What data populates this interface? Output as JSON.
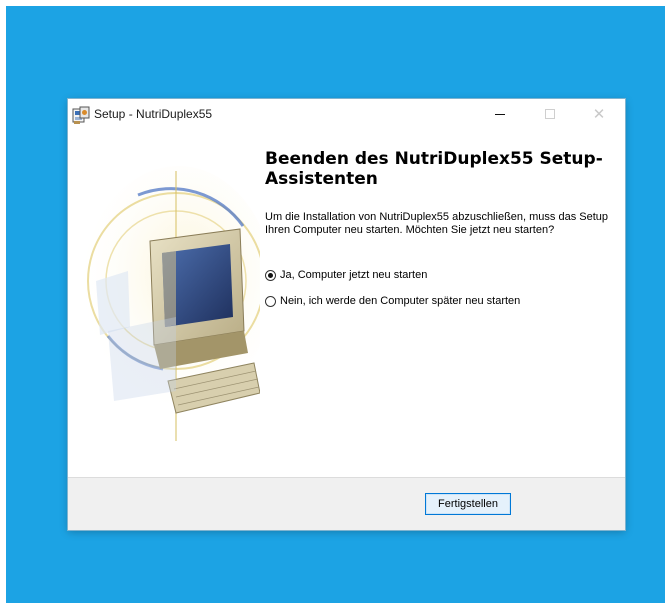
{
  "window": {
    "title": "Setup - NutriDuplex55"
  },
  "wizard": {
    "heading": "Beenden des NutriDuplex55 Setup-Assistenten",
    "description": "Um die Installation von NutriDuplex55 abzuschließen, muss das Setup Ihren Computer neu starten. Möchten Sie jetzt neu starten?",
    "options": [
      {
        "label": "Ja, Computer jetzt neu starten",
        "selected": true
      },
      {
        "label": "Nein, ich werde den Computer später neu starten",
        "selected": false
      }
    ]
  },
  "footer": {
    "finish_label": "Fertigstellen"
  },
  "icons": {
    "app": "setup-installer-icon",
    "minimize": "minimize-icon",
    "maximize": "maximize-icon",
    "close": "close-icon"
  },
  "colors": {
    "desktop_background": "#1ca3e4",
    "window_background": "#ffffff",
    "footer_background": "#f0f0f0",
    "button_border": "#0078d7"
  }
}
